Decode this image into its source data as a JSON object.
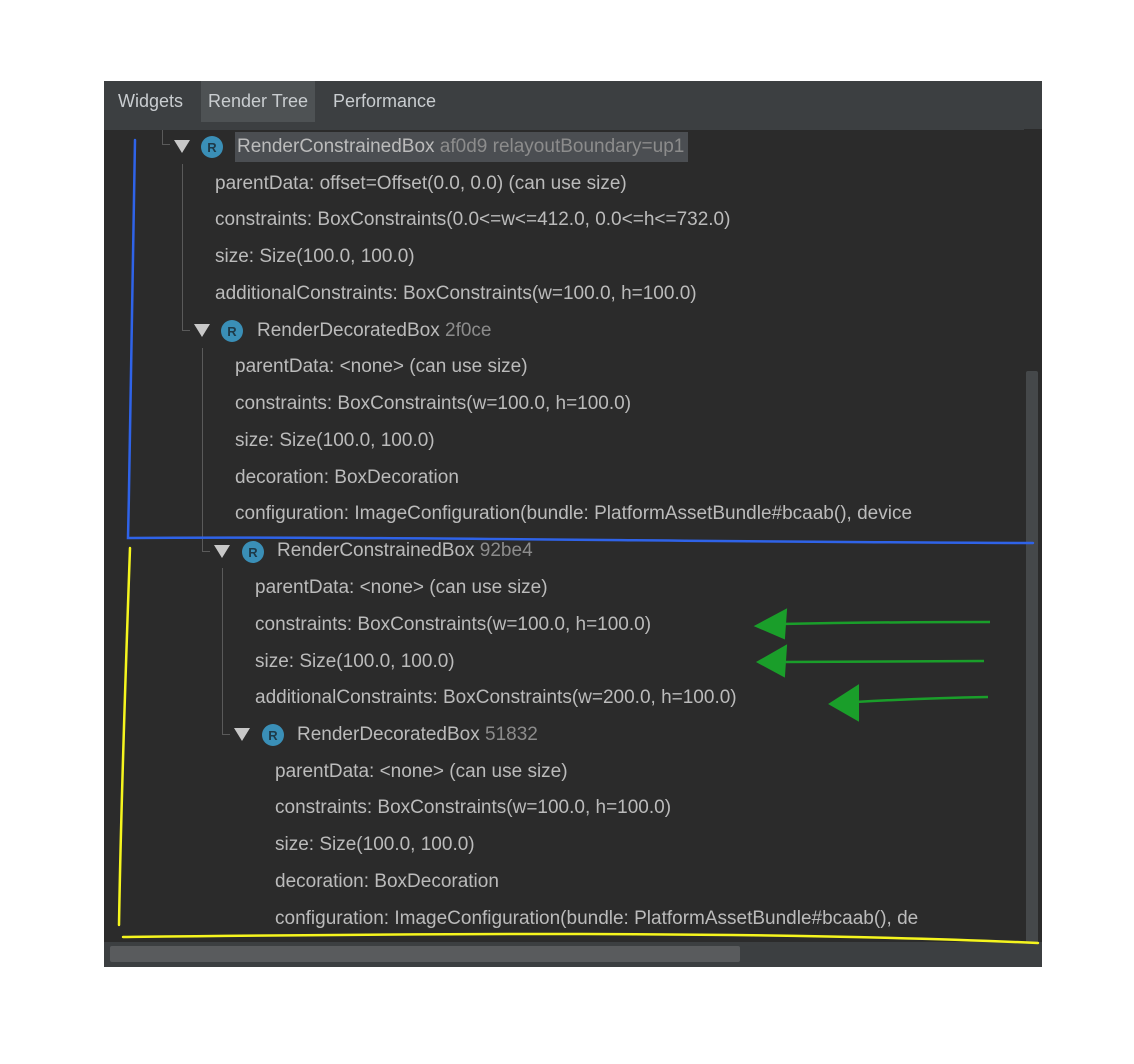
{
  "tabs": [
    {
      "label": "Widgets"
    },
    {
      "label": "Render Tree"
    },
    {
      "label": "Performance"
    }
  ],
  "active_tab": "Render Tree",
  "tree": {
    "node1": {
      "name": "RenderConstrainedBox",
      "hash": "af0d9 relayoutBoundary=up1",
      "badge": "R"
    },
    "node1_props": [
      "parentData: offset=Offset(0.0, 0.0) (can use size)",
      "constraints: BoxConstraints(0.0<=w<=412.0, 0.0<=h<=732.0)",
      "size: Size(100.0, 100.0)",
      "additionalConstraints: BoxConstraints(w=100.0, h=100.0)"
    ],
    "node2": {
      "name": "RenderDecoratedBox",
      "hash": "2f0ce",
      "badge": "R"
    },
    "node2_props": [
      "parentData: <none> (can use size)",
      "constraints: BoxConstraints(w=100.0, h=100.0)",
      "size: Size(100.0, 100.0)",
      "decoration: BoxDecoration",
      "configuration: ImageConfiguration(bundle: PlatformAssetBundle#bcaab(), device"
    ],
    "node3": {
      "name": "RenderConstrainedBox",
      "hash": "92be4",
      "badge": "R"
    },
    "node3_props": [
      "parentData: <none> (can use size)",
      "constraints: BoxConstraints(w=100.0, h=100.0)",
      "size: Size(100.0, 100.0)",
      "additionalConstraints: BoxConstraints(w=200.0, h=100.0)"
    ],
    "node4": {
      "name": "RenderDecoratedBox",
      "hash": "51832",
      "badge": "R"
    },
    "node4_props": [
      "parentData: <none> (can use size)",
      "constraints: BoxConstraints(w=100.0, h=100.0)",
      "size: Size(100.0, 100.0)",
      "decoration: BoxDecoration",
      "configuration: ImageConfiguration(bundle: PlatformAssetBundle#bcaab(), de"
    ]
  },
  "colors": {
    "blue_annotation": "#2f63e8",
    "yellow_annotation": "#f5f51e",
    "green_arrows": "#1a9e2a"
  }
}
